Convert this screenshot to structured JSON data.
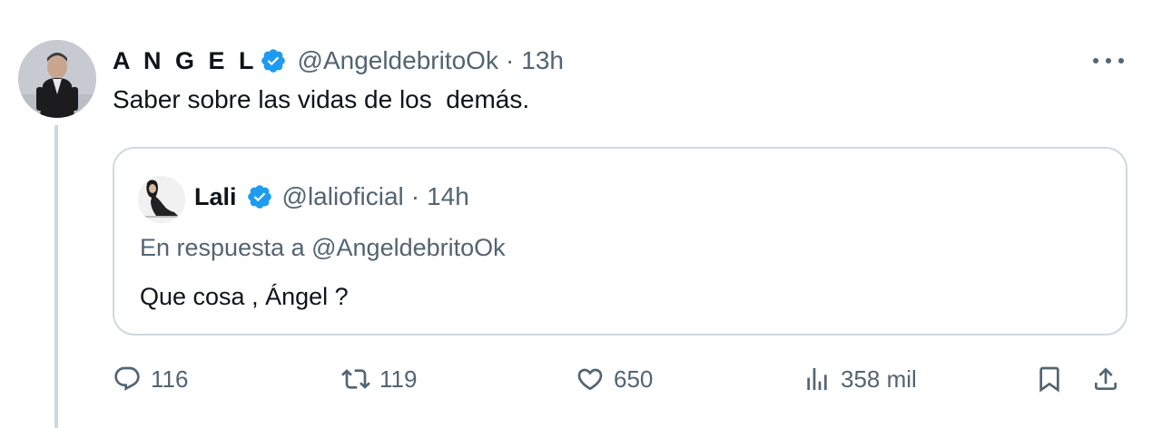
{
  "tweet": {
    "author_name": "A N G E L",
    "author_handle": "@AngeldebritoOk",
    "separator": "·",
    "time": "13h",
    "text": "Saber sobre las vidas de los  demás.",
    "verified": true
  },
  "quoted": {
    "author_name": "Lali",
    "author_handle": "@lalioficial",
    "separator": "·",
    "time": "14h",
    "reply_prefix": "En respuesta a ",
    "reply_handle": "@AngeldebritoOk",
    "text": "Que cosa , Ángel ?",
    "verified": true
  },
  "actions": {
    "replies": "116",
    "retweets": "119",
    "likes": "650",
    "views": "358 mil"
  },
  "colors": {
    "text_primary": "#0f1419",
    "text_secondary": "#536471",
    "verified_blue": "#1d9bf0",
    "border": "#cfd9de"
  },
  "icons": [
    "more-icon",
    "verified-icon",
    "reply-icon",
    "retweet-icon",
    "like-icon",
    "views-icon",
    "bookmark-icon",
    "share-icon"
  ]
}
